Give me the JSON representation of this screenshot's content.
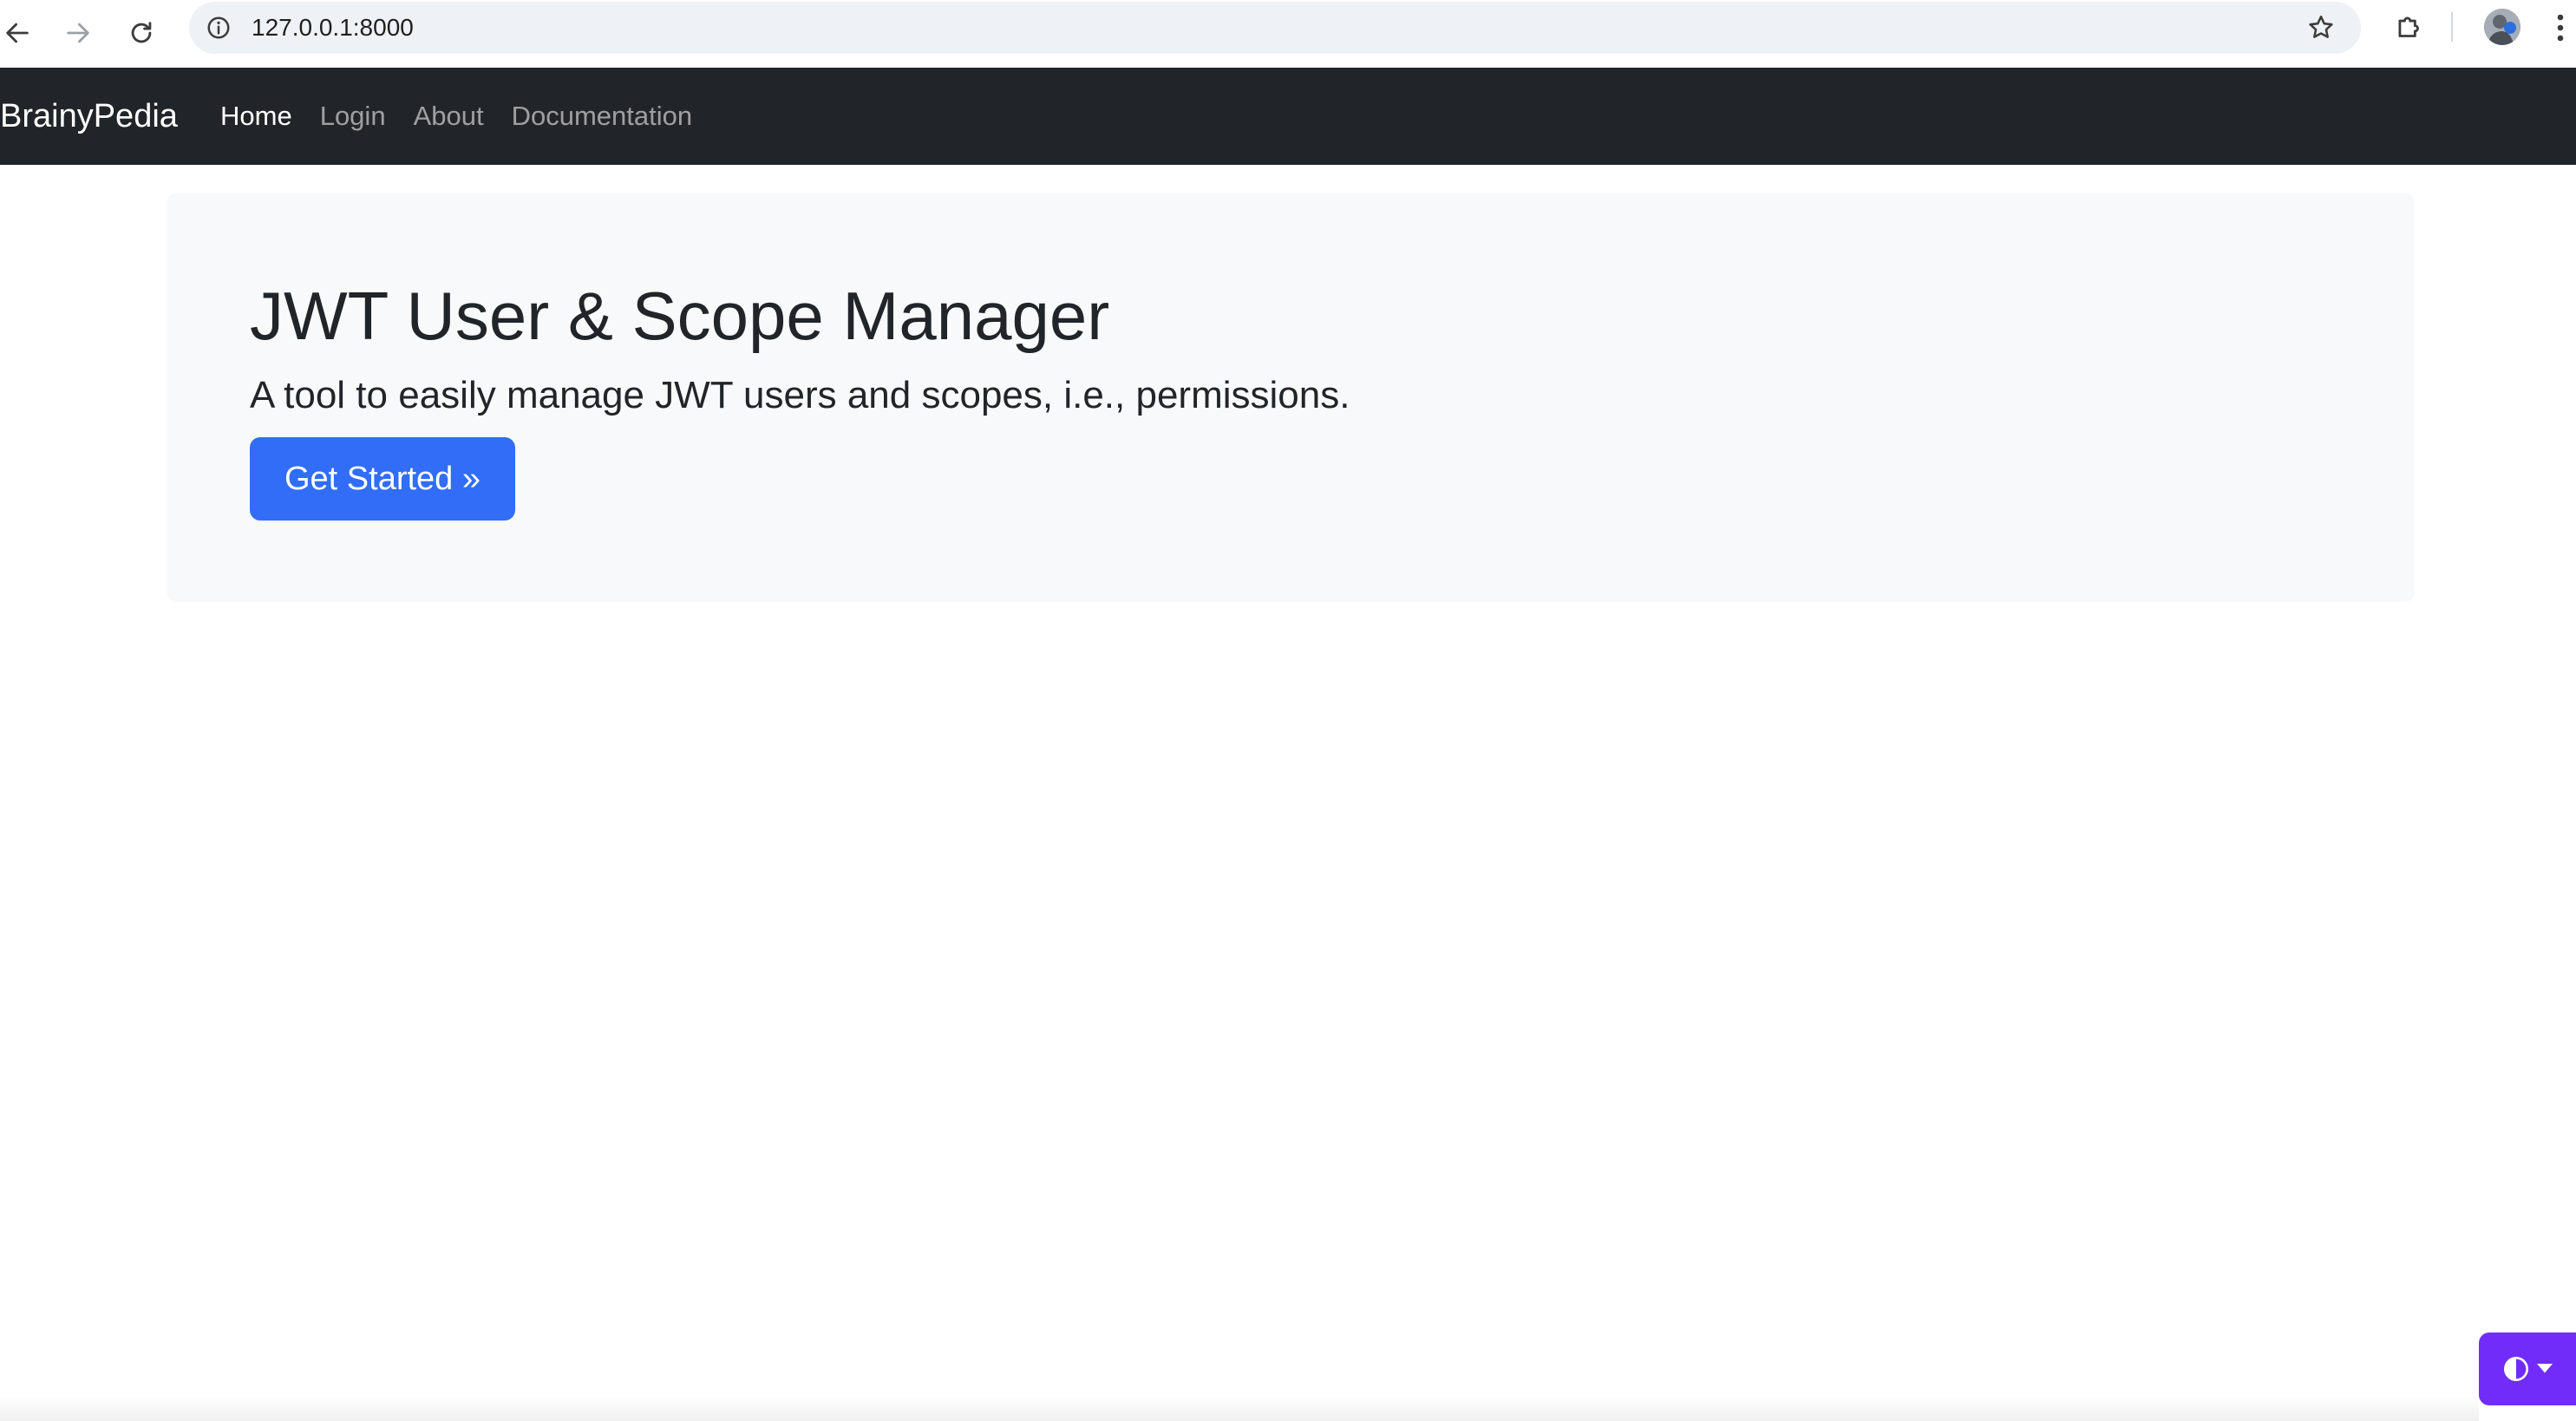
{
  "browser": {
    "url": "127.0.0.1:8000",
    "icons": {
      "back": "arrow-left-icon",
      "forward": "arrow-right-icon",
      "reload": "reload-icon",
      "site_info": "info-circle-icon",
      "bookmark": "star-icon",
      "extensions": "puzzle-icon",
      "menu": "kebab-menu-icon"
    }
  },
  "navbar": {
    "brand": "BrainyPedia",
    "links": [
      {
        "label": "Home",
        "active": true
      },
      {
        "label": "Login",
        "active": false
      },
      {
        "label": "About",
        "active": false
      },
      {
        "label": "Documentation",
        "active": false
      }
    ],
    "background": "#212529"
  },
  "hero": {
    "title": "JWT User & Scope Manager",
    "subtitle": "A tool to easily manage JWT users and scopes, i.e., permissions.",
    "cta_label": "Get Started »",
    "cta_color": "#316df7",
    "background": "#f8f9fa"
  },
  "theme_toggle": {
    "icon": "circle-half-icon",
    "color": "#712cf9"
  }
}
